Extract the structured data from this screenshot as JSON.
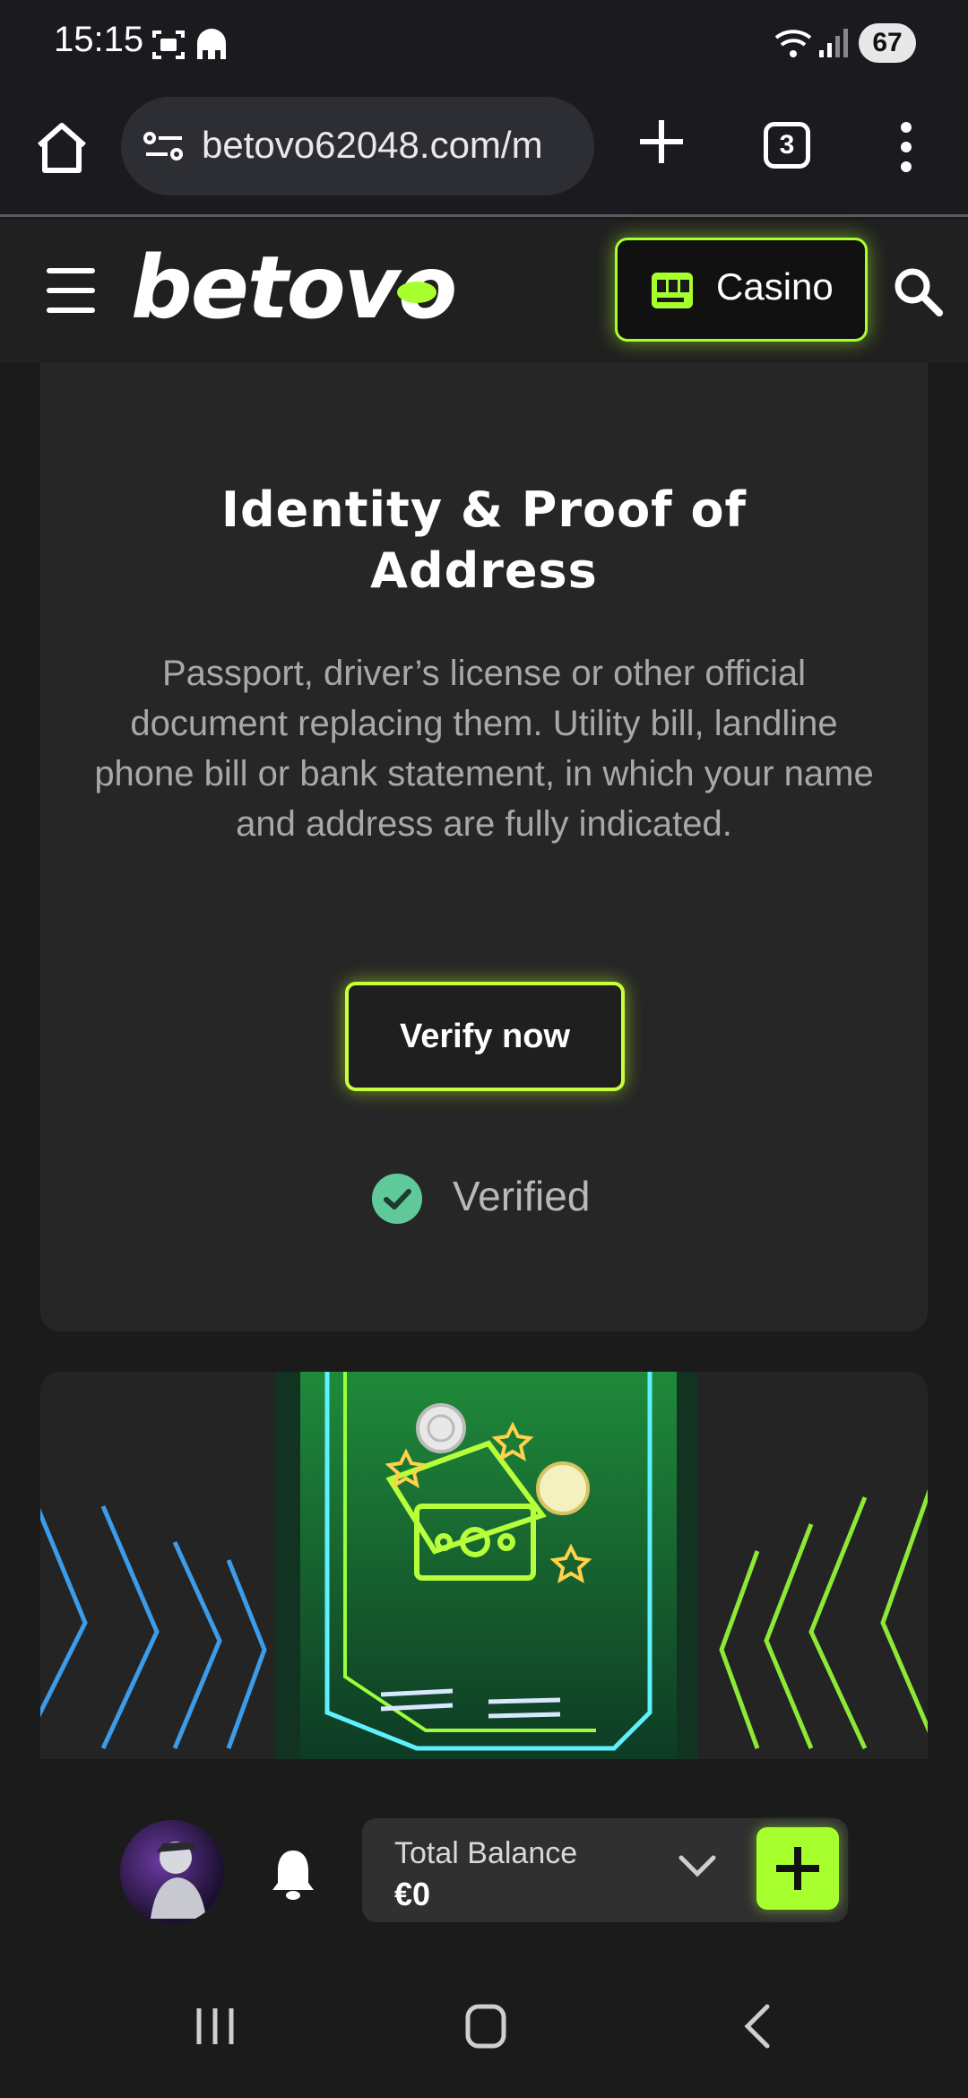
{
  "status_bar": {
    "time": "15:15",
    "battery": "67"
  },
  "browser": {
    "url": "betovo62048.com/m",
    "tab_count": "3"
  },
  "site_header": {
    "logo_text": "betovo",
    "casino_label": "Casino",
    "accent_color": "#a8ff2e"
  },
  "verify_card": {
    "title_line1": "Identity & Proof of",
    "title_line2": "Address",
    "description": "Passport, driver’s license or other official document replacing them. Utility bill, landline phone bill or bank statement, in which your name and address are fully indicated.",
    "verify_button": "Verify now",
    "status": "Verified",
    "status_color": "#5fc99a"
  },
  "bottom_bar": {
    "balance_label": "Total Balance",
    "balance_value": "€0"
  },
  "icons": [
    "home-icon",
    "site-info-icon",
    "new-tab-icon",
    "tabs-icon",
    "more-icon",
    "hamburger-icon",
    "slot-machine-icon",
    "search-icon",
    "check-icon",
    "bell-icon",
    "chevron-down-icon",
    "plus-icon",
    "recents-icon",
    "home-nav-icon",
    "back-icon"
  ]
}
